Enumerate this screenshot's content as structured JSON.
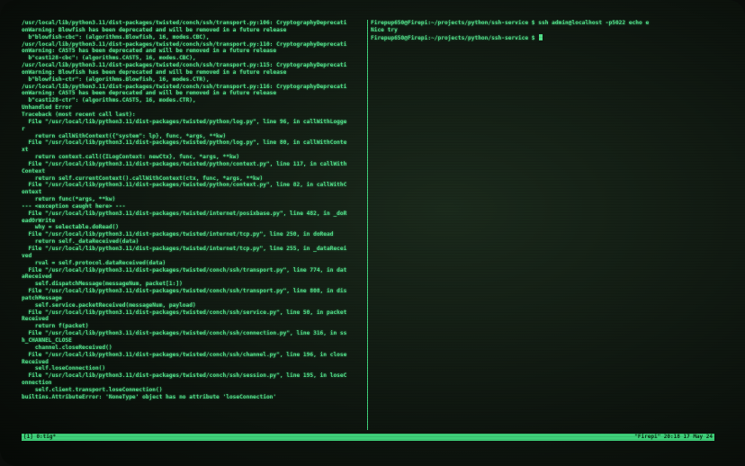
{
  "terminal": {
    "left_pane_lines": [
      "/usr/local/lib/python3.11/dist-packages/twisted/conch/ssh/transport.py:106: CryptographyDeprecati",
      "onWarning: Blowfish has been deprecated and will be removed in a future release",
      "  b\"blowfish-cbc\": (algorithms.Blowfish, 16, modes.CBC),",
      "/usr/local/lib/python3.11/dist-packages/twisted/conch/ssh/transport.py:110: CryptographyDeprecati",
      "onWarning: CAST5 has been deprecated and will be removed in a future release",
      "  b\"cast128-cbc\": (algorithms.CAST5, 16, modes.CBC),",
      "/usr/local/lib/python3.11/dist-packages/twisted/conch/ssh/transport.py:115: CryptographyDeprecati",
      "onWarning: Blowfish has been deprecated and will be removed in a future release",
      "  b\"blowfish-ctr\": (algorithms.Blowfish, 16, modes.CTR),",
      "/usr/local/lib/python3.11/dist-packages/twisted/conch/ssh/transport.py:116: CryptographyDeprecati",
      "onWarning: CAST5 has been deprecated and will be removed in a future release",
      "  b\"cast128-ctr\": (algorithms.CAST5, 16, modes.CTR),",
      "Unhandled Error",
      "Traceback (most recent call last):",
      "  File \"/usr/local/lib/python3.11/dist-packages/twisted/python/log.py\", line 96, in callWithLogge",
      "r",
      "    return callWithContext({\"system\": lp}, func, *args, **kw)",
      "  File \"/usr/local/lib/python3.11/dist-packages/twisted/python/log.py\", line 80, in callWithConte",
      "xt",
      "    return context.call({ILogContext: newCtx}, func, *args, **kw)",
      "  File \"/usr/local/lib/python3.11/dist-packages/twisted/python/context.py\", line 117, in callWith",
      "Context",
      "    return self.currentContext().callWithContext(ctx, func, *args, **kw)",
      "  File \"/usr/local/lib/python3.11/dist-packages/twisted/python/context.py\", line 82, in callWithC",
      "ontext",
      "    return func(*args, **kw)",
      "--- <exception caught here> ---",
      "  File \"/usr/local/lib/python3.11/dist-packages/twisted/internet/posixbase.py\", line 482, in _doR",
      "eadOrWrite",
      "    why = selectable.doRead()",
      "  File \"/usr/local/lib/python3.11/dist-packages/twisted/internet/tcp.py\", line 250, in doRead",
      "    return self._dataReceived(data)",
      "  File \"/usr/local/lib/python3.11/dist-packages/twisted/internet/tcp.py\", line 255, in _dataRecei",
      "ved",
      "    rval = self.protocol.dataReceived(data)",
      "  File \"/usr/local/lib/python3.11/dist-packages/twisted/conch/ssh/transport.py\", line 774, in dat",
      "aReceived",
      "    self.dispatchMessage(messageNum, packet[1:])",
      "  File \"/usr/local/lib/python3.11/dist-packages/twisted/conch/ssh/transport.py\", line 808, in dis",
      "patchMessage",
      "    self.service.packetReceived(messageNum, payload)",
      "  File \"/usr/local/lib/python3.11/dist-packages/twisted/conch/ssh/service.py\", line 50, in packet",
      "Received",
      "    return f(packet)",
      "  File \"/usr/local/lib/python3.11/dist-packages/twisted/conch/ssh/connection.py\", line 316, in ss",
      "h_CHANNEL_CLOSE",
      "    channel.closeReceived()",
      "  File \"/usr/local/lib/python3.11/dist-packages/twisted/conch/ssh/channel.py\", line 196, in close",
      "Received",
      "    self.loseConnection()",
      "  File \"/usr/local/lib/python3.11/dist-packages/twisted/conch/ssh/session.py\", line 195, in loseC",
      "onnection",
      "    self.client.transport.loseConnection()",
      "builtins.AttributeError: 'NoneType' object has no attribute 'loseConnection'"
    ],
    "right_pane_lines": [
      "Firepup650@Firepi:~/projects/python/ssh-service $ ssh admin@localhost -p5022 echo e",
      "Nice try",
      "Firepup650@Firepi:~/projects/python/ssh-service $ "
    ],
    "status_left": "[1] 0:tig*",
    "status_right": "\"Firepi\" 20:18 17 May 24"
  },
  "colors": {
    "phosphor_green": "#52e08a",
    "status_bar": "#3fd17a",
    "screen_bg": "#0f1710"
  }
}
